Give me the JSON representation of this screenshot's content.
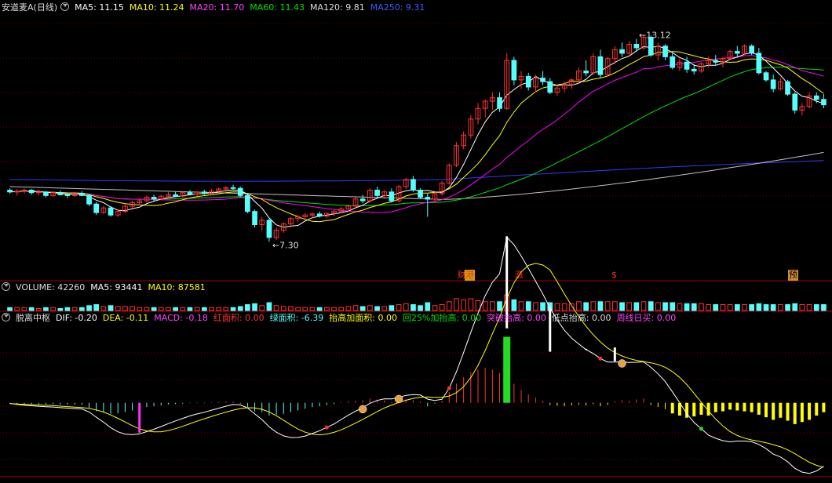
{
  "price_header": {
    "title": "安道麦A(日线)",
    "ma5": "MA5: 11.15",
    "ma10": "MA10: 11.24",
    "ma20": "MA20: 11.70",
    "ma60": "MA60: 11.43",
    "ma120": "MA120: 9.81",
    "ma250": "MA250: 9.31"
  },
  "volume_header": {
    "title": "VOLUME: 42260",
    "ma5": "MA5: 93441",
    "ma10": "MA10: 87581"
  },
  "indicator_header": {
    "title": "脱离中枢",
    "dif": "DIF: -0.20",
    "dea": "DEA: -0.11",
    "macd": "MACD: -0.18",
    "red_area": "红面积: 0.00",
    "green_area": "绿面积: -6.39",
    "raise_add": "抬高加面积: 0.00",
    "pullback": "回25%加抬高: 0.00",
    "breakout": "突破抬高: 0.00",
    "low_raise": "低点抬高: 0.00",
    "weekly_buy": "周线日买: 0.00"
  },
  "colors": {
    "up": "#ff3232",
    "down": "#54ffff",
    "ma5": "#ffffff",
    "ma10": "#ffff00",
    "ma20": "#ff00ff",
    "ma60": "#00e000",
    "ma120": "#c0c0c0",
    "ma250": "#2d3cff",
    "grid": "#6b0000"
  },
  "badges": [
    {
      "text": "财",
      "color": "#ff3232",
      "bg": "#000"
    },
    {
      "text": "港",
      "color": "#ff3232",
      "bg": "#c8a000"
    },
    {
      "text": "涨",
      "color": "#ff3232",
      "bg": "#000"
    },
    {
      "text": "$",
      "color": "#ff3232",
      "bg": "#000"
    },
    {
      "text": "预",
      "color": "#000",
      "bg": "#d08a30"
    }
  ],
  "chart_data": {
    "type": "candlestick",
    "high_label": "13.12",
    "low_label": "7.30",
    "price_range": [
      6.6,
      13.7
    ],
    "macd_range": [
      -1.7,
      1.8
    ],
    "candles": [
      [
        8.75,
        8.8,
        8.65,
        8.7
      ],
      [
        8.7,
        8.78,
        8.6,
        8.72
      ],
      [
        8.72,
        8.8,
        8.66,
        8.75
      ],
      [
        8.75,
        8.78,
        8.62,
        8.68
      ],
      [
        8.68,
        8.76,
        8.6,
        8.7
      ],
      [
        8.7,
        8.72,
        8.55,
        8.6
      ],
      [
        8.6,
        8.7,
        8.55,
        8.68
      ],
      [
        8.68,
        8.74,
        8.6,
        8.62
      ],
      [
        8.62,
        8.66,
        8.52,
        8.6
      ],
      [
        8.6,
        8.7,
        8.56,
        8.66
      ],
      [
        8.66,
        8.72,
        8.58,
        8.6
      ],
      [
        8.6,
        8.62,
        8.3,
        8.36
      ],
      [
        8.36,
        8.42,
        8.05,
        8.12
      ],
      [
        8.12,
        8.3,
        8.08,
        8.25
      ],
      [
        8.25,
        8.3,
        8.0,
        8.05
      ],
      [
        8.05,
        8.2,
        8.0,
        8.15
      ],
      [
        8.15,
        8.35,
        8.1,
        8.3
      ],
      [
        8.3,
        8.45,
        8.25,
        8.4
      ],
      [
        8.4,
        8.5,
        8.32,
        8.45
      ],
      [
        8.45,
        8.6,
        8.4,
        8.55
      ],
      [
        8.55,
        8.62,
        8.45,
        8.5
      ],
      [
        8.5,
        8.62,
        8.46,
        8.58
      ],
      [
        8.58,
        8.7,
        8.52,
        8.62
      ],
      [
        8.62,
        8.7,
        8.55,
        8.58
      ],
      [
        8.58,
        8.72,
        8.55,
        8.68
      ],
      [
        8.68,
        8.75,
        8.6,
        8.64
      ],
      [
        8.64,
        8.72,
        8.58,
        8.7
      ],
      [
        8.7,
        8.76,
        8.62,
        8.66
      ],
      [
        8.66,
        8.78,
        8.6,
        8.72
      ],
      [
        8.72,
        8.82,
        8.66,
        8.78
      ],
      [
        8.78,
        8.86,
        8.7,
        8.82
      ],
      [
        8.82,
        8.9,
        8.75,
        8.8
      ],
      [
        8.8,
        8.85,
        8.55,
        8.6
      ],
      [
        8.6,
        8.62,
        8.1,
        8.15
      ],
      [
        8.15,
        8.2,
        7.7,
        7.78
      ],
      [
        7.78,
        8.0,
        7.6,
        7.9
      ],
      [
        7.9,
        7.95,
        7.3,
        7.42
      ],
      [
        7.42,
        7.7,
        7.35,
        7.62
      ],
      [
        7.62,
        7.85,
        7.55,
        7.8
      ],
      [
        7.8,
        8.0,
        7.7,
        7.95
      ],
      [
        7.95,
        8.05,
        7.85,
        8.0
      ],
      [
        8.0,
        8.1,
        7.9,
        8.05
      ],
      [
        8.05,
        8.12,
        7.95,
        8.08
      ],
      [
        8.08,
        8.15,
        7.98,
        8.02
      ],
      [
        8.02,
        8.12,
        7.96,
        8.1
      ],
      [
        8.1,
        8.2,
        8.02,
        8.15
      ],
      [
        8.15,
        8.28,
        8.1,
        8.22
      ],
      [
        8.22,
        8.35,
        8.15,
        8.3
      ],
      [
        8.3,
        8.55,
        8.25,
        8.5
      ],
      [
        8.5,
        8.62,
        8.38,
        8.45
      ],
      [
        8.45,
        8.8,
        8.4,
        8.75
      ],
      [
        8.75,
        8.85,
        8.55,
        8.6
      ],
      [
        8.6,
        8.75,
        8.5,
        8.7
      ],
      [
        8.7,
        8.8,
        8.4,
        8.45
      ],
      [
        8.45,
        8.9,
        8.4,
        8.85
      ],
      [
        8.85,
        9.1,
        8.78,
        9.05
      ],
      [
        9.05,
        9.15,
        8.7,
        8.75
      ],
      [
        8.75,
        8.8,
        8.5,
        8.55
      ],
      [
        8.55,
        8.65,
        8.0,
        8.5
      ],
      [
        8.5,
        8.7,
        8.4,
        8.65
      ],
      [
        8.65,
        9.0,
        8.6,
        8.95
      ],
      [
        8.95,
        9.5,
        8.9,
        9.45
      ],
      [
        9.45,
        10.1,
        9.4,
        10.0
      ],
      [
        10.0,
        10.4,
        9.9,
        10.3
      ],
      [
        10.3,
        10.85,
        10.2,
        10.75
      ],
      [
        10.75,
        11.2,
        10.6,
        11.05
      ],
      [
        11.05,
        11.3,
        10.8,
        11.25
      ],
      [
        11.25,
        11.5,
        11.0,
        11.35
      ],
      [
        11.35,
        11.5,
        10.95,
        11.05
      ],
      [
        11.05,
        12.6,
        11.0,
        12.4
      ],
      [
        12.4,
        12.5,
        11.7,
        11.85
      ],
      [
        11.85,
        12.1,
        11.6,
        11.95
      ],
      [
        11.95,
        12.05,
        11.55,
        11.65
      ],
      [
        11.65,
        12.0,
        11.5,
        11.9
      ],
      [
        11.9,
        12.1,
        11.7,
        11.8
      ],
      [
        11.8,
        11.9,
        11.45,
        11.5
      ],
      [
        11.5,
        11.7,
        11.4,
        11.62
      ],
      [
        11.62,
        11.8,
        11.5,
        11.72
      ],
      [
        11.72,
        11.9,
        11.6,
        11.85
      ],
      [
        11.85,
        12.2,
        11.75,
        12.1
      ],
      [
        12.1,
        12.4,
        11.95,
        12.05
      ],
      [
        12.05,
        12.6,
        12.0,
        12.5
      ],
      [
        12.5,
        12.7,
        11.9,
        12.0
      ],
      [
        12.0,
        12.5,
        11.95,
        12.45
      ],
      [
        12.45,
        12.8,
        12.3,
        12.7
      ],
      [
        12.7,
        12.9,
        12.5,
        12.6
      ],
      [
        12.6,
        12.95,
        12.5,
        12.85
      ],
      [
        12.85,
        13.0,
        12.65,
        12.75
      ],
      [
        12.75,
        13.12,
        12.7,
        13.05
      ],
      [
        13.05,
        13.1,
        12.5,
        12.55
      ],
      [
        12.55,
        12.9,
        12.4,
        12.8
      ],
      [
        12.8,
        12.85,
        12.4,
        12.5
      ],
      [
        12.5,
        12.6,
        12.15,
        12.2
      ],
      [
        12.2,
        12.45,
        12.1,
        12.35
      ],
      [
        12.35,
        12.5,
        12.05,
        12.15
      ],
      [
        12.15,
        12.3,
        12.0,
        12.1
      ],
      [
        12.1,
        12.35,
        12.05,
        12.3
      ],
      [
        12.3,
        12.5,
        12.2,
        12.4
      ],
      [
        12.4,
        12.55,
        12.25,
        12.35
      ],
      [
        12.35,
        12.5,
        12.2,
        12.45
      ],
      [
        12.45,
        12.7,
        12.4,
        12.65
      ],
      [
        12.65,
        12.8,
        12.5,
        12.6
      ],
      [
        12.6,
        12.85,
        12.55,
        12.8
      ],
      [
        12.8,
        12.85,
        12.55,
        12.6
      ],
      [
        12.6,
        12.75,
        12.0,
        12.05
      ],
      [
        12.05,
        12.1,
        11.8,
        11.85
      ],
      [
        11.85,
        12.0,
        11.5,
        11.6
      ],
      [
        11.6,
        11.9,
        11.55,
        11.8
      ],
      [
        11.8,
        11.85,
        11.4,
        11.45
      ],
      [
        11.45,
        11.5,
        10.9,
        11.0
      ],
      [
        11.0,
        11.2,
        10.85,
        11.1
      ],
      [
        11.1,
        11.5,
        11.05,
        11.4
      ],
      [
        11.4,
        11.5,
        11.2,
        11.3
      ],
      [
        11.3,
        11.45,
        11.05,
        11.15
      ]
    ],
    "volume": [
      3,
      3,
      3,
      3,
      2,
      3,
      3,
      2,
      3,
      3,
      3,
      5,
      6,
      4,
      5,
      4,
      4,
      4,
      3,
      3,
      3,
      3,
      3,
      3,
      3,
      3,
      3,
      3,
      3,
      3,
      3,
      3,
      4,
      6,
      7,
      5,
      8,
      5,
      4,
      4,
      3,
      3,
      3,
      3,
      3,
      3,
      3,
      4,
      5,
      4,
      5,
      4,
      4,
      5,
      6,
      7,
      6,
      5,
      8,
      5,
      6,
      9,
      12,
      11,
      12,
      10,
      9,
      9,
      9,
      16,
      11,
      9,
      9,
      8,
      8,
      8,
      7,
      7,
      7,
      9,
      8,
      9,
      9,
      9,
      9,
      8,
      8,
      8,
      9,
      9,
      8,
      8,
      8,
      7,
      7,
      7,
      7,
      6,
      6,
      6,
      6,
      6,
      6,
      6,
      7,
      6,
      6,
      6,
      6,
      7,
      6,
      6,
      6,
      6
    ],
    "macd_hist": [
      -0.02,
      -0.03,
      -0.03,
      -0.03,
      -0.03,
      -0.03,
      -0.03,
      -0.04,
      -0.04,
      -0.04,
      -0.04,
      -0.12,
      -0.2,
      -0.22,
      -0.26,
      -0.25,
      -0.22,
      -0.18,
      -0.14,
      -0.1,
      -0.08,
      -0.06,
      -0.04,
      -0.03,
      -0.02,
      -0.01,
      -0.01,
      -0.01,
      0.01,
      0.02,
      0.03,
      0.03,
      -0.02,
      -0.1,
      -0.2,
      -0.22,
      -0.3,
      -0.28,
      -0.26,
      -0.22,
      -0.18,
      -0.14,
      -0.1,
      -0.08,
      -0.05,
      -0.03,
      0.02,
      0.04,
      0.05,
      0.06,
      0.1,
      0.08,
      0.06,
      0.02,
      0.06,
      0.09,
      0.06,
      0.03,
      -0.08,
      -0.02,
      0.05,
      0.25,
      0.45,
      0.6,
      0.72,
      0.78,
      0.82,
      0.78,
      0.7,
      1.55,
      0.45,
      0.3,
      0.2,
      0.12,
      0.05,
      -0.05,
      -0.07,
      -0.08,
      -0.06,
      -0.04,
      -0.06,
      -0.03,
      -0.08,
      -0.05,
      0.04,
      0.06,
      0.05,
      0.08,
      0.1,
      -0.05,
      -0.1,
      -0.15,
      -0.25,
      -0.3,
      -0.35,
      -0.32,
      -0.28,
      -0.3,
      -0.22,
      -0.2,
      -0.16,
      -0.18,
      -0.2,
      -0.22,
      -0.28,
      -0.34,
      -0.4,
      -0.35,
      -0.42,
      -0.5,
      -0.45,
      -0.4,
      -0.3,
      -0.22
    ]
  }
}
